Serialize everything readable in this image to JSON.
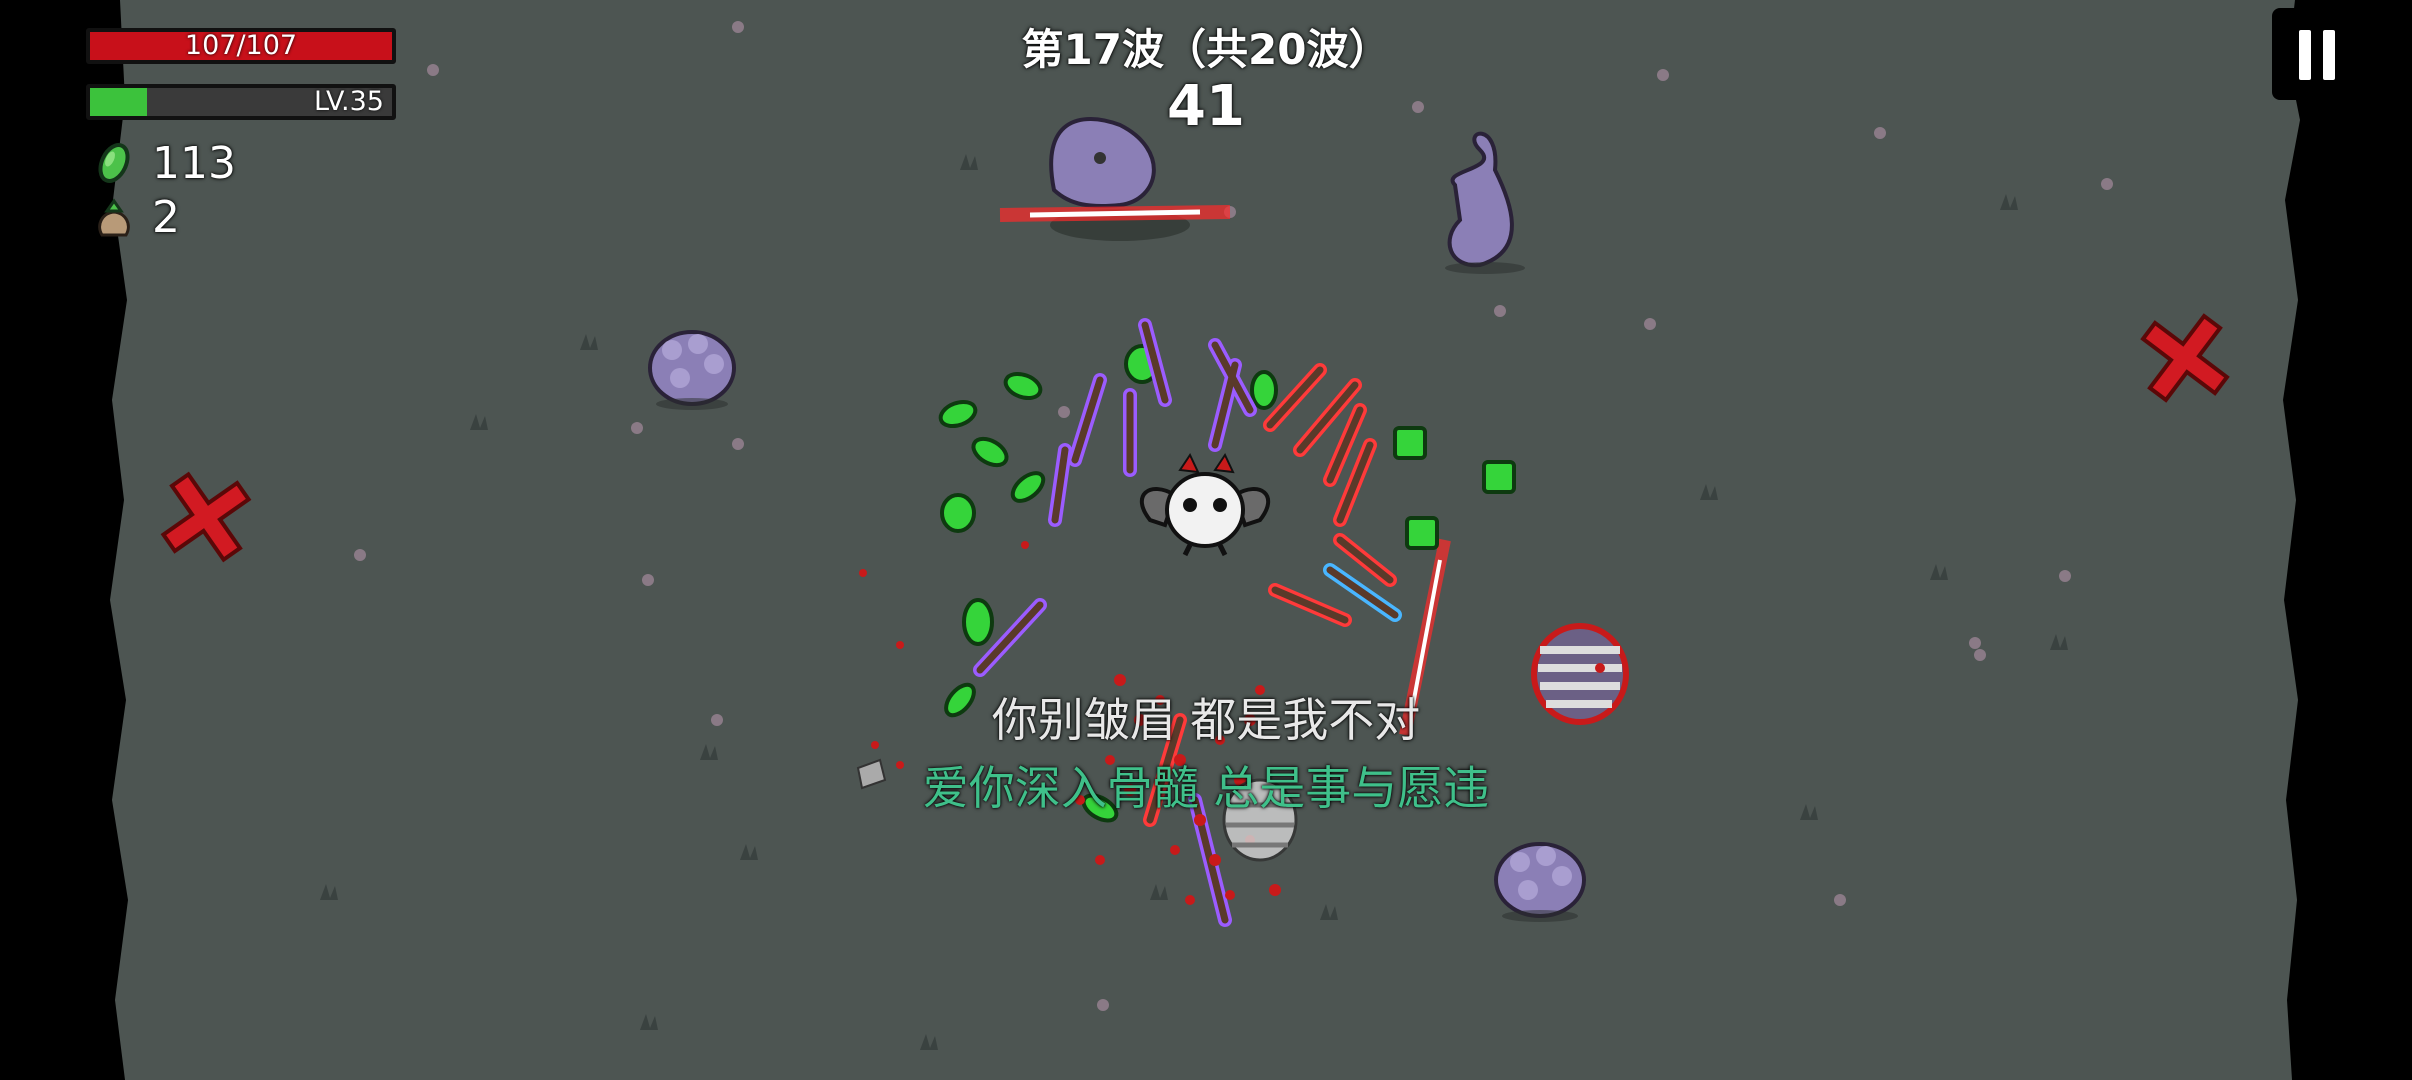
{
  "hud": {
    "hp_text": "107/107",
    "hp_fraction": 1.0,
    "level_text": "LV.35",
    "xp_fraction": 0.19,
    "materials_count": "113",
    "bag_count": "2",
    "material_icon": "green-material-icon",
    "bag_icon": "loot-bag-icon"
  },
  "wave": {
    "title": "第17波（共20波）",
    "timer": "41"
  },
  "pause": {
    "icon": "pause-icon"
  },
  "lyrics": {
    "line1": "你别皱眉 都是我不对",
    "line2": "爱你深入骨髓 总是事与愿违",
    "line2_color": "#3fc08a"
  },
  "colors": {
    "ground": "#4d5552",
    "hp": "#c8101a",
    "xp": "#3cc23c",
    "enemy": "#8e76c4",
    "laser": "#ff2a2a",
    "material": "#35d43a"
  }
}
